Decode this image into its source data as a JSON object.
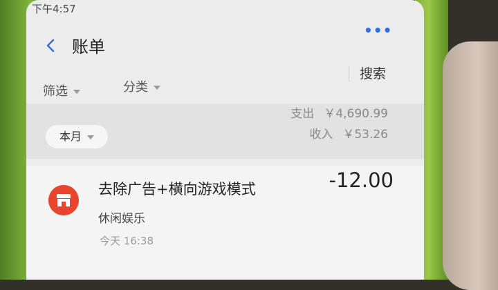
{
  "status_bar": {
    "time": "下午4:57"
  },
  "header": {
    "title": "账单",
    "more": "•••"
  },
  "toolbar": {
    "filter_label": "筛选",
    "category_label": "分类",
    "search_label": "搜索"
  },
  "summary": {
    "period": "本月",
    "expense_label": "支出",
    "expense_value": "￥4,690.99",
    "income_label": "收入",
    "income_value": "￥53.26"
  },
  "transactions": [
    {
      "title": "去除广告+横向游戏模式",
      "amount": "-12.00",
      "category": "休闲娱乐",
      "time": "今天 16:38",
      "icon": "store-icon"
    }
  ],
  "colors": {
    "accent": "#2f6fe0",
    "merchant_icon": "#e8452e"
  }
}
